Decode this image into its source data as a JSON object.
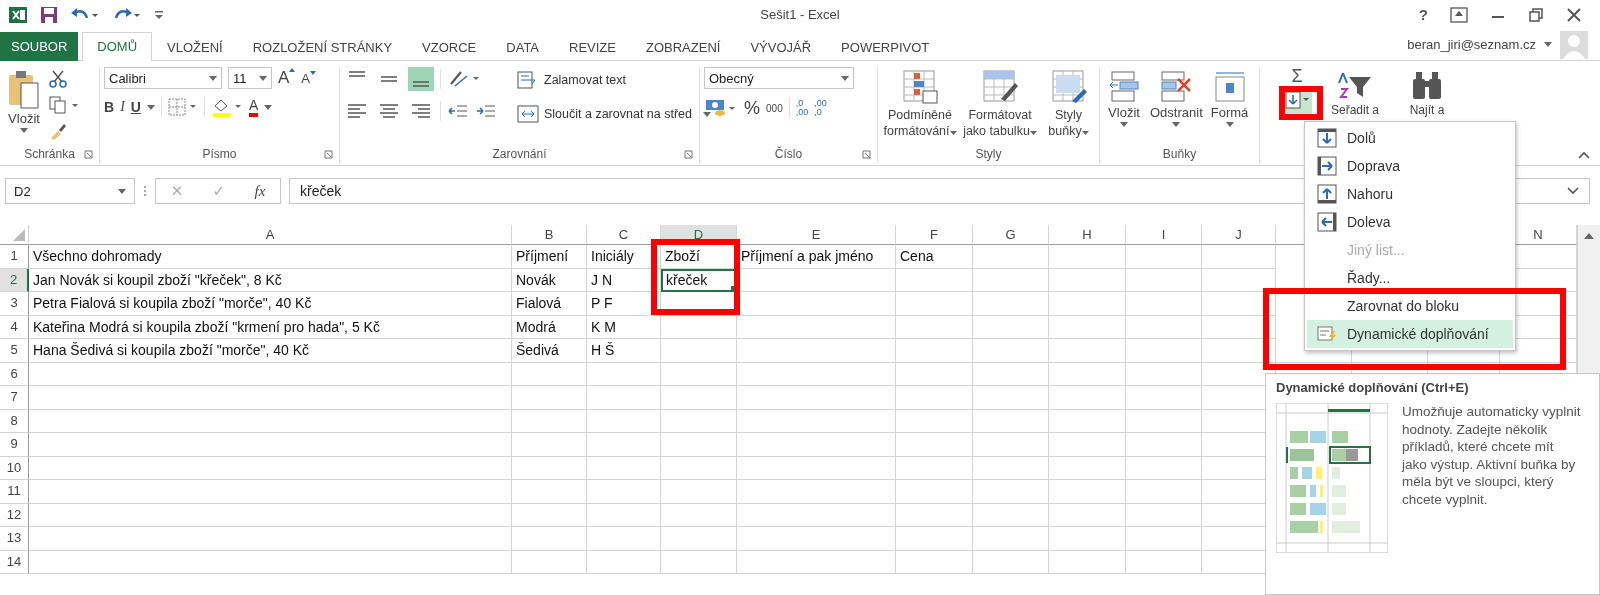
{
  "title_bar": {
    "title": "Sešit1 - Excel",
    "help": "?"
  },
  "tabs": [
    {
      "label": "SOUBOR",
      "kind": "file",
      "selected": false
    },
    {
      "label": "DOMŮ",
      "kind": "tab",
      "selected": true
    },
    {
      "label": "VLOŽENÍ",
      "kind": "tab",
      "selected": false
    },
    {
      "label": "ROZLOŽENÍ STRÁNKY",
      "kind": "tab",
      "selected": false
    },
    {
      "label": "VZORCE",
      "kind": "tab",
      "selected": false
    },
    {
      "label": "DATA",
      "kind": "tab",
      "selected": false
    },
    {
      "label": "REVIZE",
      "kind": "tab",
      "selected": false
    },
    {
      "label": "ZOBRAZENÍ",
      "kind": "tab",
      "selected": false
    },
    {
      "label": "VÝVOJÁŘ",
      "kind": "tab",
      "selected": false
    },
    {
      "label": "POWERPIVOT",
      "kind": "tab",
      "selected": false
    }
  ],
  "account": {
    "email": "beran_jiri@seznam.cz"
  },
  "ribbon": {
    "clipboard": {
      "label": "Schránka",
      "paste": "Vložit"
    },
    "font": {
      "label": "Písmo",
      "name": "Calibri",
      "size": "11",
      "grow": "A",
      "shrink": "A",
      "bold": "B",
      "italic": "I",
      "underline": "U",
      "color_letter": "A"
    },
    "alignment": {
      "label": "Zarovnání",
      "vertical": [
        {
          "selected": false
        },
        {
          "selected": false
        },
        {
          "selected": true
        }
      ],
      "horizontal": [
        {
          "selected": false
        },
        {
          "selected": false
        },
        {
          "selected": false
        }
      ],
      "wrap": "Zalamovat text",
      "merge": "Sloučit a zarovnat na střed"
    },
    "number": {
      "label": "Číslo",
      "format": "Obecný",
      "percent": "%",
      "thousands": "000",
      "increase_decimal": [
        ",0",
        ",00"
      ],
      "decrease_decimal": [
        ",00",
        ",0"
      ]
    },
    "styles": {
      "label": "Styly",
      "buttons": [
        {
          "lines": [
            "Podmíněné",
            "formátování"
          ],
          "kind": "conditional"
        },
        {
          "lines": [
            "Formátovat",
            "jako tabulku"
          ],
          "kind": "table"
        },
        {
          "lines": [
            "Styly",
            "buňky"
          ],
          "kind": "cellstyle"
        }
      ]
    },
    "cells": {
      "label": "Buňky",
      "buttons": [
        {
          "label": "Vložit",
          "kind": "insert"
        },
        {
          "label": "Odstranit",
          "kind": "delete"
        },
        {
          "label": "Formá",
          "kind": "format"
        }
      ]
    },
    "editing": {
      "autosum": "Σ",
      "fill_open": true,
      "sort": "Seřadit a",
      "find": "Najít a"
    }
  },
  "formula_bar": {
    "name_box": "D2",
    "cancel": "✕",
    "enter": "✓",
    "fx": "fx",
    "value": "křeček"
  },
  "sheet": {
    "columns": [
      {
        "label": "A",
        "selected": false
      },
      {
        "label": "B",
        "selected": false
      },
      {
        "label": "C",
        "selected": false
      },
      {
        "label": "D",
        "selected": true
      },
      {
        "label": "E",
        "selected": false
      },
      {
        "label": "F",
        "selected": false
      },
      {
        "label": "G",
        "selected": false
      },
      {
        "label": "H",
        "selected": false
      },
      {
        "label": "I",
        "selected": false
      },
      {
        "label": "J",
        "selected": false
      },
      {
        "selected": false
      },
      {
        "label": "N",
        "selected": false
      }
    ],
    "rows": [
      {
        "label": "1",
        "selected": false,
        "cells": [
          {
            "text": "Všechno dohromady",
            "selected": false
          },
          {
            "text": "Příjmení",
            "selected": false
          },
          {
            "text": "Iniciály",
            "selected": false
          },
          {
            "text": "Zboží",
            "selected": false
          },
          {
            "text": "Příjmení a pak jméno",
            "selected": false
          },
          {
            "text": "Cena",
            "selected": false
          }
        ]
      },
      {
        "label": "2",
        "selected": true,
        "cells": [
          {
            "text": "Jan Novák si koupil zboží \"křeček\", 8 Kč",
            "selected": false
          },
          {
            "text": "Novák",
            "selected": false
          },
          {
            "text": "J N",
            "selected": false
          },
          {
            "text": "křeček",
            "selected": true
          },
          {
            "selected": false
          },
          {
            "selected": false
          }
        ]
      },
      {
        "label": "3",
        "selected": false,
        "cells": [
          {
            "text": "Petra Fialová si koupila zboží \"morče\", 40 Kč",
            "selected": false
          },
          {
            "text": "Fialová",
            "selected": false
          },
          {
            "text": "P F",
            "selected": false
          },
          {
            "selected": false
          },
          {
            "selected": false
          },
          {
            "selected": false
          }
        ]
      },
      {
        "label": "4",
        "selected": false,
        "cells": [
          {
            "text": "Kateřina Modrá si koupila zboží \"krmení pro hada\", 5 Kč",
            "selected": false
          },
          {
            "text": "Modrá",
            "selected": false
          },
          {
            "text": "K M",
            "selected": false
          },
          {
            "selected": false
          },
          {
            "selected": false
          },
          {
            "selected": false
          }
        ]
      },
      {
        "label": "5",
        "selected": false,
        "cells": [
          {
            "text": "Hana Šedivá si koupila zboží \"morče\", 40 Kč",
            "selected": false
          },
          {
            "text": "Šedivá",
            "selected": false
          },
          {
            "text": "H Š",
            "selected": false
          },
          {
            "selected": false
          },
          {
            "selected": false
          },
          {
            "selected": false
          }
        ]
      },
      {
        "label": "6",
        "selected": false
      },
      {
        "label": "7",
        "selected": false
      },
      {
        "label": "8",
        "selected": false
      },
      {
        "label": "9",
        "selected": false
      },
      {
        "label": "10",
        "selected": false
      },
      {
        "label": "11",
        "selected": false
      },
      {
        "label": "12",
        "selected": false
      },
      {
        "label": "13",
        "selected": false
      },
      {
        "label": "14",
        "selected": false
      }
    ]
  },
  "fill_menu": {
    "items": [
      {
        "label": "Dolů",
        "kind": "down",
        "disabled": false,
        "selected": false
      },
      {
        "label": "Doprava",
        "kind": "right",
        "disabled": false,
        "selected": false
      },
      {
        "label": "Nahoru",
        "kind": "up",
        "disabled": false,
        "selected": false
      },
      {
        "label": "Doleva",
        "kind": "left",
        "disabled": false,
        "selected": false
      },
      {
        "label": "Jiný list...",
        "kind": "plain",
        "disabled": true,
        "selected": false
      },
      {
        "label": "Řady...",
        "kind": "plain",
        "disabled": false,
        "selected": false
      },
      {
        "label": "Zarovnat do bloku",
        "kind": "plain",
        "disabled": false,
        "selected": false
      },
      {
        "label": "Dynamické doplňování",
        "kind": "flash",
        "disabled": false,
        "selected": true
      }
    ]
  },
  "tooltip": {
    "title": "Dynamické doplňování (Ctrl+E)",
    "body": "Umožňuje automaticky vyplnit hodnoty. Zadejte několik příkladů, které chcete mít jako výstup. Aktivní buňka by měla být ve sloupci, který chcete vyplnit."
  }
}
